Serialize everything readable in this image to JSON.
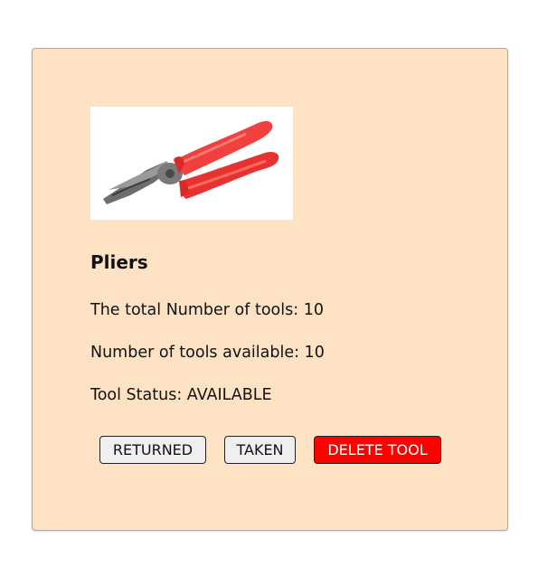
{
  "tool": {
    "image_alt": "Pliers",
    "name": "Pliers",
    "total_label": "The total Number of tools: 10",
    "available_label": "Number of tools available: 10",
    "status_label": "Tool Status: AVAILABLE"
  },
  "actions": {
    "returned_label": "RETURNED",
    "taken_label": "TAKEN",
    "delete_label": "DELETE TOOL"
  },
  "colors": {
    "card_background": "#fde3c4",
    "delete_button": "#ff0000",
    "handle_red": "#f04040"
  }
}
